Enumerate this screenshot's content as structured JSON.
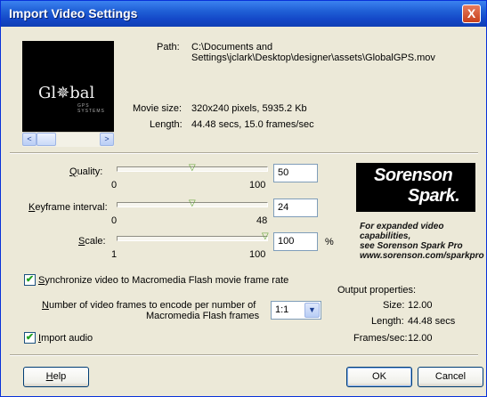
{
  "window": {
    "title": "Import Video Settings",
    "close_glyph": "X"
  },
  "preview": {
    "logo_text": "Gl✵bal",
    "logo_sub": "GPS SYSTEMS",
    "scroll_left": "<",
    "scroll_right": ">"
  },
  "info": {
    "path_label": "Path:",
    "path_line1": "C:\\Documents and",
    "path_line2": "Settings\\jclark\\Desktop\\designer\\assets\\GlobalGPS.mov",
    "movie_size_label": "Movie size:",
    "movie_size_value": "320x240 pixels, 5935.2 Kb",
    "length_label": "Length:",
    "length_value": "44.48 secs, 15.0 frames/sec"
  },
  "sliders": {
    "quality": {
      "label_key": "Q",
      "label_rest": "uality:",
      "min": "0",
      "max": "100",
      "value": "50",
      "fraction": 0.5
    },
    "keyframe": {
      "label_key": "K",
      "label_rest": "eyframe interval:",
      "min": "0",
      "max": "48",
      "value": "24",
      "fraction": 0.5
    },
    "scale": {
      "label_key": "S",
      "label_rest": "cale:",
      "min": "1",
      "max": "100",
      "value": "100",
      "unit": "%",
      "fraction": 1.0
    }
  },
  "sorenson": {
    "brand_line1": "Sorenson",
    "brand_line2": "Spark.",
    "promo_line1": "For expanded video capabilities,",
    "promo_line2": "see Sorenson Spark Pro",
    "promo_line3": "www.sorenson.com/sparkpro"
  },
  "options": {
    "sync_checked": true,
    "sync_key": "S",
    "sync_rest": "ynchronize video to Macromedia Flash movie frame rate",
    "frames_key": "N",
    "frames_line1_rest": "umber of video frames to encode per number of",
    "frames_line2": "Macromedia Flash frames",
    "frames_ratio": "1:1",
    "audio_checked": true,
    "audio_key": "I",
    "audio_rest": "mport audio"
  },
  "output": {
    "header": "Output properties:",
    "size_label": "Size:",
    "size_value": "12.00",
    "length_label": "Length:",
    "length_value": "44.48 secs",
    "fps_label": "Frames/sec:",
    "fps_value": "12.00"
  },
  "buttons": {
    "help_key": "H",
    "help_rest": "elp",
    "ok": "OK",
    "cancel": "Cancel"
  },
  "icons": {
    "checkmark": "✔",
    "dropdown": "▼",
    "slider_thumb": "▽"
  }
}
